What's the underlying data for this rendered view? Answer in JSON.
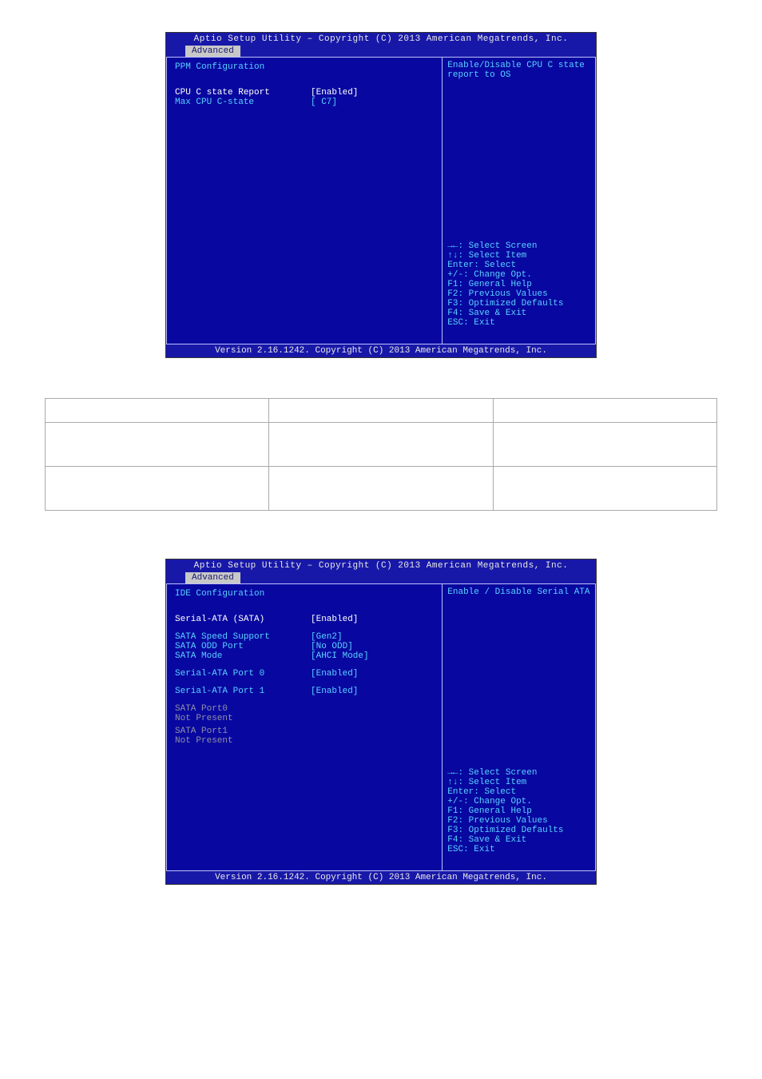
{
  "bios1": {
    "header_title": "Aptio Setup Utility – Copyright (C) 2013 American Megatrends, Inc.",
    "tab": "Advanced",
    "section": "PPM Configuration",
    "settings": [
      {
        "label": "CPU C state Report",
        "value": "[Enabled]",
        "selected": true
      },
      {
        "label": "Max CPU C-state",
        "value": "[ C7]",
        "selected": false
      }
    ],
    "help": "Enable/Disable CPU C state report to OS",
    "nav": [
      "→←: Select Screen",
      "↑↓: Select Item",
      "Enter: Select",
      "+/-: Change Opt.",
      "F1: General Help",
      "F2: Previous Values",
      "F3: Optimized Defaults",
      "F4: Save & Exit",
      "ESC: Exit"
    ],
    "footer": "Version 2.16.1242. Copyright (C) 2013 American Megatrends, Inc."
  },
  "doc_table": {
    "headers": [
      "",
      "",
      ""
    ],
    "rows": [
      [
        "",
        "",
        ""
      ],
      [
        "",
        "",
        ""
      ]
    ]
  },
  "bios2": {
    "header_title": "Aptio Setup Utility – Copyright (C) 2013 American Megatrends, Inc.",
    "tab": "Advanced",
    "section": "IDE Configuration",
    "settings": [
      {
        "label": "Serial-ATA (SATA)",
        "value": "[Enabled]",
        "selected": true,
        "gap_after": true
      },
      {
        "label": "SATA Speed Support",
        "value": "[Gen2]"
      },
      {
        "label": "SATA ODD Port",
        "value": "[No ODD]"
      },
      {
        "label": "SATA Mode",
        "value": "[AHCI Mode]",
        "gap_after": true
      },
      {
        "label": "Serial-ATA Port 0",
        "value": "[Enabled]",
        "gap_after": true
      },
      {
        "label": "Serial-ATA Port 1",
        "value": "[Enabled]",
        "gap_after": true
      }
    ],
    "status": [
      "SATA Port0",
      "Not Present",
      "",
      "SATA Port1",
      "Not Present"
    ],
    "help": "Enable / Disable Serial ATA",
    "nav": [
      "→←: Select Screen",
      "↑↓: Select Item",
      "Enter: Select",
      "+/-: Change Opt.",
      "F1: General Help",
      "F2: Previous Values",
      "F3: Optimized Defaults",
      "F4: Save & Exit",
      "ESC: Exit"
    ],
    "footer": "Version 2.16.1242. Copyright (C) 2013 American Megatrends, Inc."
  }
}
